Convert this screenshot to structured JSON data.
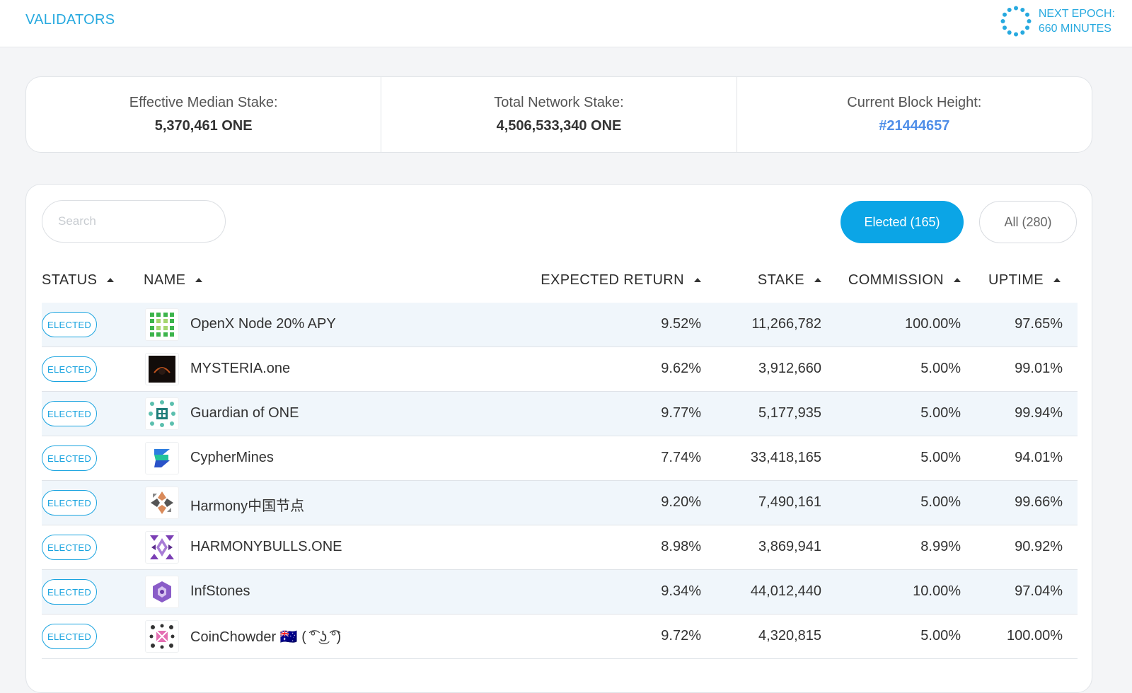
{
  "header": {
    "title": "VALIDATORS",
    "epoch_line1": "NEXT EPOCH:",
    "epoch_line2": "660 MINUTES"
  },
  "stats": {
    "median_label": "Effective Median Stake:",
    "median_value": "5,370,461 ONE",
    "total_label": "Total Network Stake:",
    "total_value": "4,506,533,340 ONE",
    "block_label": "Current Block Height:",
    "block_value": "#21444657"
  },
  "controls": {
    "search_placeholder": "Search",
    "elected_button": "Elected (165)",
    "all_button": "All (280)"
  },
  "table": {
    "headers": {
      "status": "STATUS",
      "name": "NAME",
      "expected_return": "EXPECTED RETURN",
      "stake": "STAKE",
      "commission": "COMMISSION",
      "uptime": "UPTIME"
    },
    "rows": [
      {
        "status": "ELECTED",
        "name": "OpenX Node 20% APY",
        "return": "9.52%",
        "stake": "11,266,782",
        "commission": "100.00%",
        "uptime": "97.65%",
        "logo": "openx-logo"
      },
      {
        "status": "ELECTED",
        "name": "MYSTERIA.one",
        "return": "9.62%",
        "stake": "3,912,660",
        "commission": "5.00%",
        "uptime": "99.01%",
        "logo": "mysteria-logo"
      },
      {
        "status": "ELECTED",
        "name": "Guardian of ONE",
        "return": "9.77%",
        "stake": "5,177,935",
        "commission": "5.00%",
        "uptime": "99.94%",
        "logo": "guardian-logo"
      },
      {
        "status": "ELECTED",
        "name": "CypherMines",
        "return": "7.74%",
        "stake": "33,418,165",
        "commission": "5.00%",
        "uptime": "94.01%",
        "logo": "cyphermines-logo"
      },
      {
        "status": "ELECTED",
        "name": "Harmony中国节点",
        "return": "9.20%",
        "stake": "7,490,161",
        "commission": "5.00%",
        "uptime": "99.66%",
        "logo": "harmony-china-logo"
      },
      {
        "status": "ELECTED",
        "name": "HARMONYBULLS.ONE",
        "return": "8.98%",
        "stake": "3,869,941",
        "commission": "8.99%",
        "uptime": "90.92%",
        "logo": "harmonybulls-logo"
      },
      {
        "status": "ELECTED",
        "name": "InfStones",
        "return": "9.34%",
        "stake": "44,012,440",
        "commission": "10.00%",
        "uptime": "97.04%",
        "logo": "infstones-logo"
      },
      {
        "status": "ELECTED",
        "name": "CoinChowder 🇦🇺 ( ͡° ͜ʖ ͡°)",
        "return": "9.72%",
        "stake": "4,320,815",
        "commission": "5.00%",
        "uptime": "100.00%",
        "logo": "coinchowder-logo"
      }
    ]
  },
  "colors": {
    "accent": "#0ba5e6",
    "link": "#4f8ee8",
    "row_alt": "#f0f6fb"
  }
}
